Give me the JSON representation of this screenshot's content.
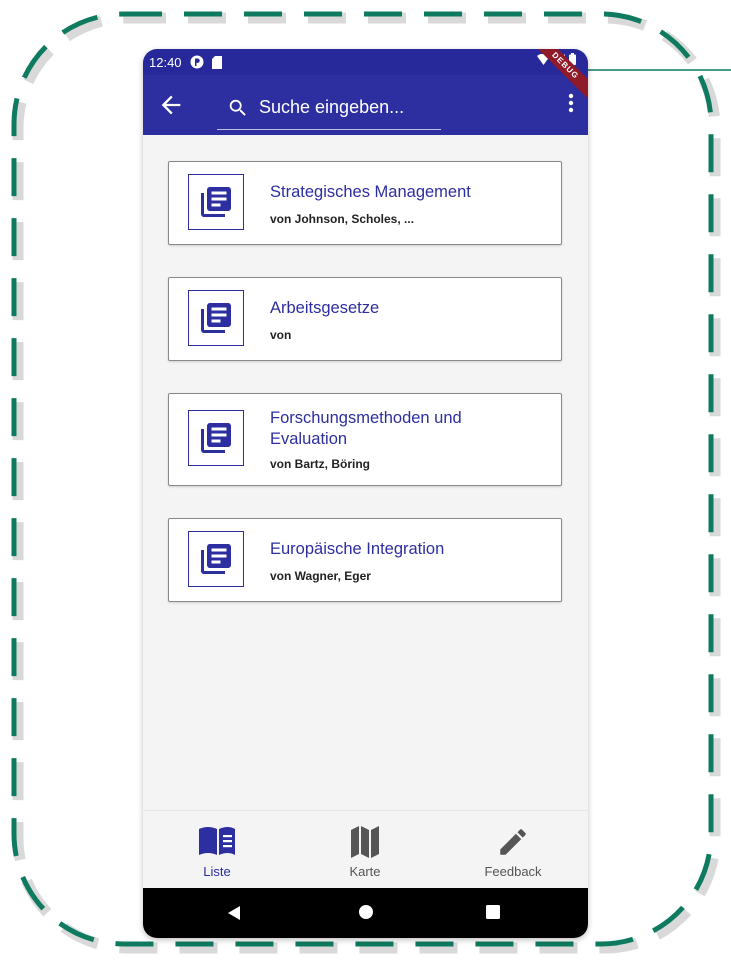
{
  "status_bar": {
    "time": "12:40"
  },
  "debug_banner": "DEBUG",
  "search": {
    "placeholder": "Suche eingeben..."
  },
  "books": [
    {
      "title": "Strategisches Management",
      "authors": "von Johnson, Scholes, ..."
    },
    {
      "title": "Arbeitsgesetze",
      "authors": "von"
    },
    {
      "title": "Forschungsmethoden und Evaluation",
      "authors": "von Bartz, Böring"
    },
    {
      "title": "Europäische Integration",
      "authors": "von Wagner, Eger"
    }
  ],
  "bottom_nav": [
    {
      "label": "Liste",
      "icon": "book-open-icon",
      "active": true
    },
    {
      "label": "Karte",
      "icon": "map-icon",
      "active": false
    },
    {
      "label": "Feedback",
      "icon": "pencil-icon",
      "active": false
    }
  ],
  "colors": {
    "primary": "#2d2ea0",
    "frame": "#0e7a5f",
    "background": "#f4f4f4",
    "inactive": "#555555"
  }
}
